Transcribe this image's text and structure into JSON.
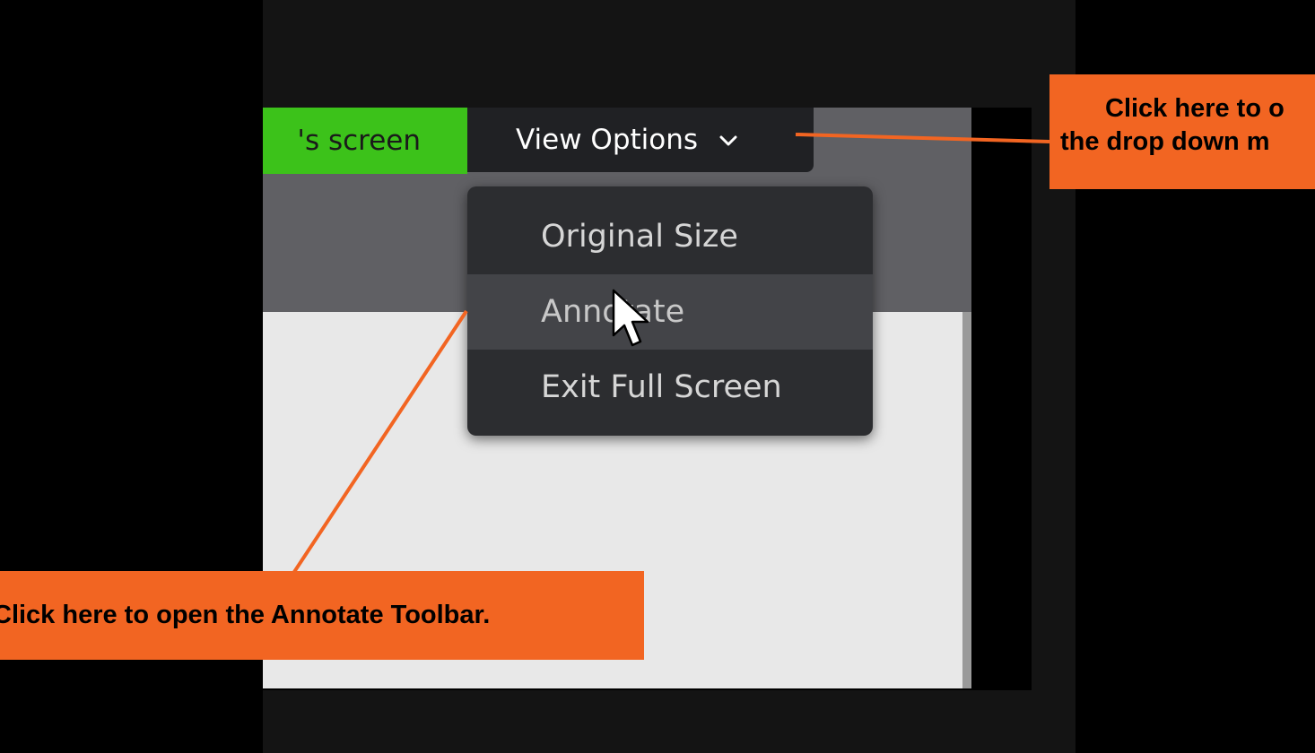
{
  "screen_tab": {
    "label": "'s screen",
    "color": "#3cc21a"
  },
  "view_options": {
    "label": "View Options",
    "icon": "chevron-down-icon"
  },
  "dropdown": {
    "items": [
      {
        "label": "Original Size"
      },
      {
        "label": "Annotate",
        "hovered": true
      },
      {
        "label": "Exit Full Screen"
      }
    ]
  },
  "callouts": {
    "dropdown_hint": {
      "line1": "Click here to o",
      "line2": "the drop down m"
    },
    "annotate_hint": {
      "text": "Click here to open the Annotate Toolbar."
    },
    "color": "#f26522"
  },
  "cursor": {
    "icon": "mouse-pointer-icon"
  }
}
